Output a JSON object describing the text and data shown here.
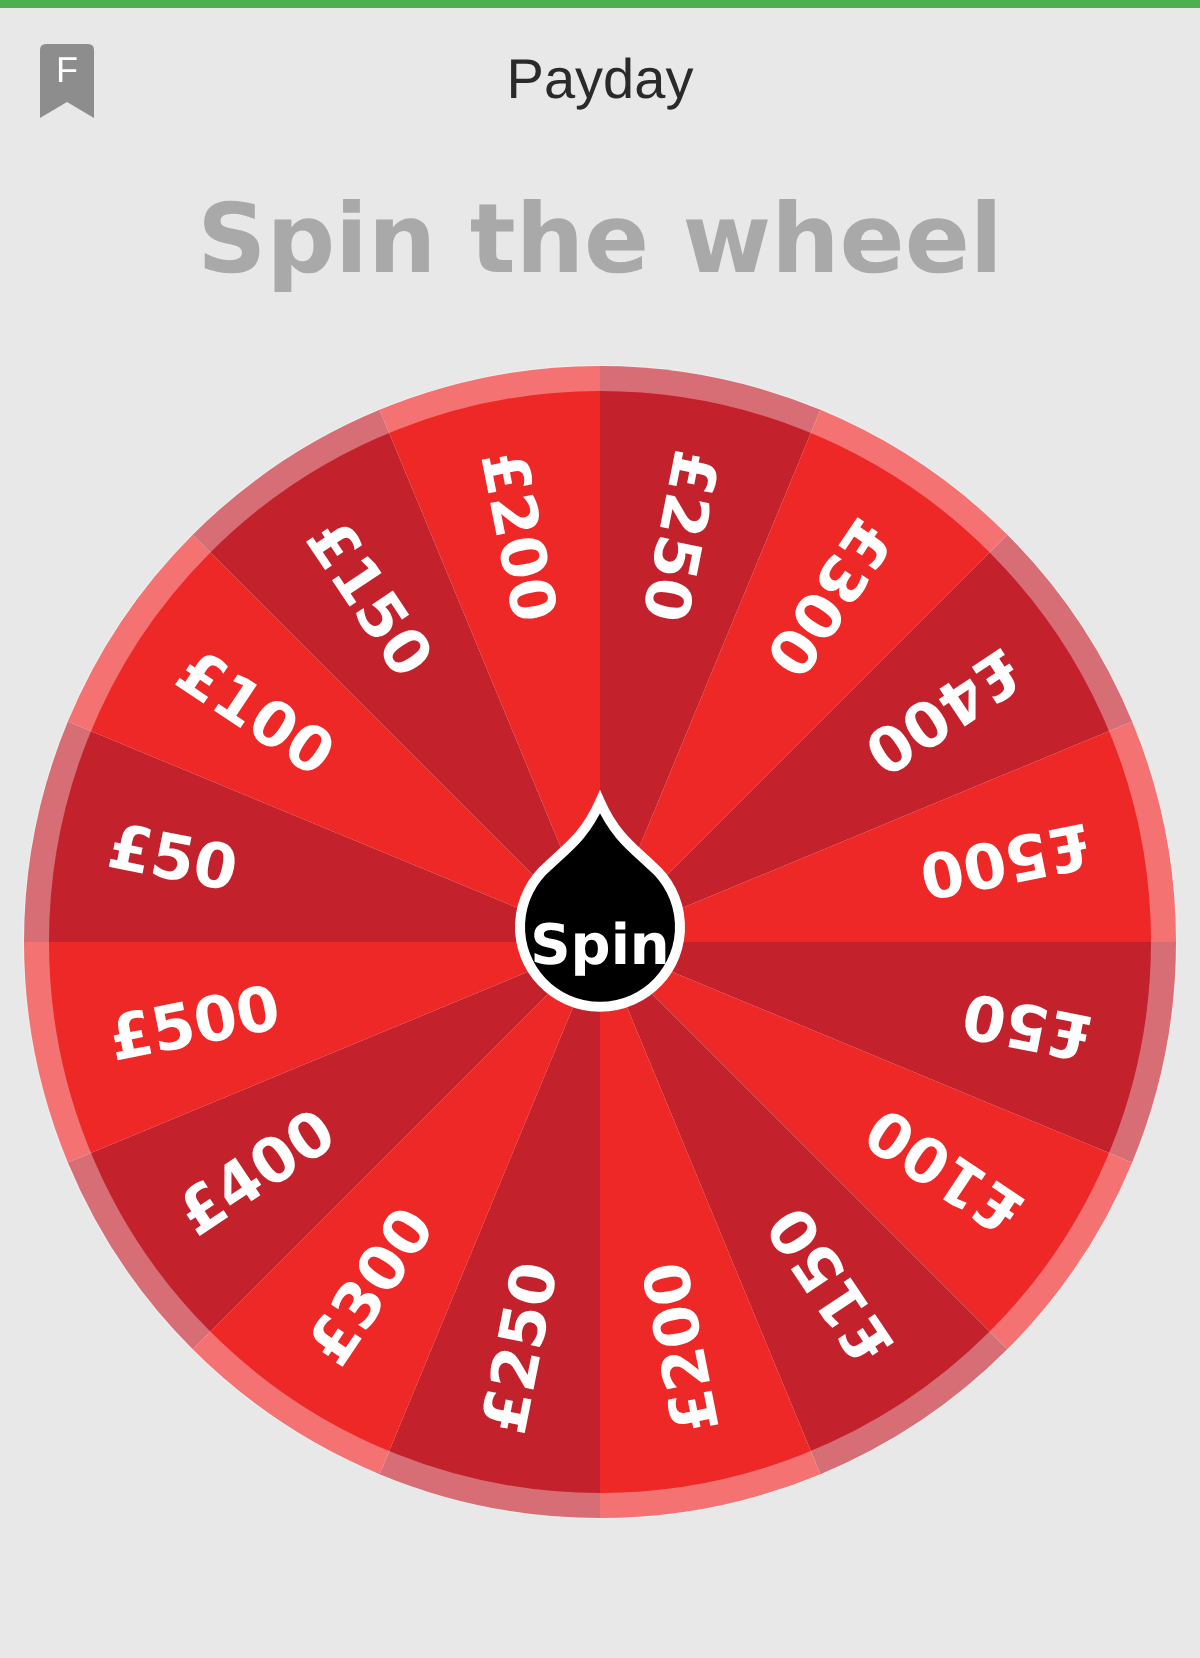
{
  "header": {
    "badge": "F",
    "title": "Payday"
  },
  "heading": "Spin the wheel",
  "wheel": {
    "segments": [
      {
        "label": "£250",
        "color": "#c3212b"
      },
      {
        "label": "£300",
        "color": "#ee2727"
      },
      {
        "label": "£400",
        "color": "#c3212b"
      },
      {
        "label": "£500",
        "color": "#ee2727"
      },
      {
        "label": "£50",
        "color": "#c3212b"
      },
      {
        "label": "£100",
        "color": "#ee2727"
      },
      {
        "label": "£150",
        "color": "#c3212b"
      },
      {
        "label": "£200",
        "color": "#ee2727"
      },
      {
        "label": "£250",
        "color": "#c3212b"
      },
      {
        "label": "£300",
        "color": "#ee2727"
      },
      {
        "label": "£400",
        "color": "#c3212b"
      },
      {
        "label": "£500",
        "color": "#ee2727"
      },
      {
        "label": "£50",
        "color": "#c3212b"
      },
      {
        "label": "£100",
        "color": "#ee2727"
      },
      {
        "label": "£150",
        "color": "#c3212b"
      },
      {
        "label": "£200",
        "color": "#ee2727"
      }
    ],
    "button": "Spin"
  }
}
